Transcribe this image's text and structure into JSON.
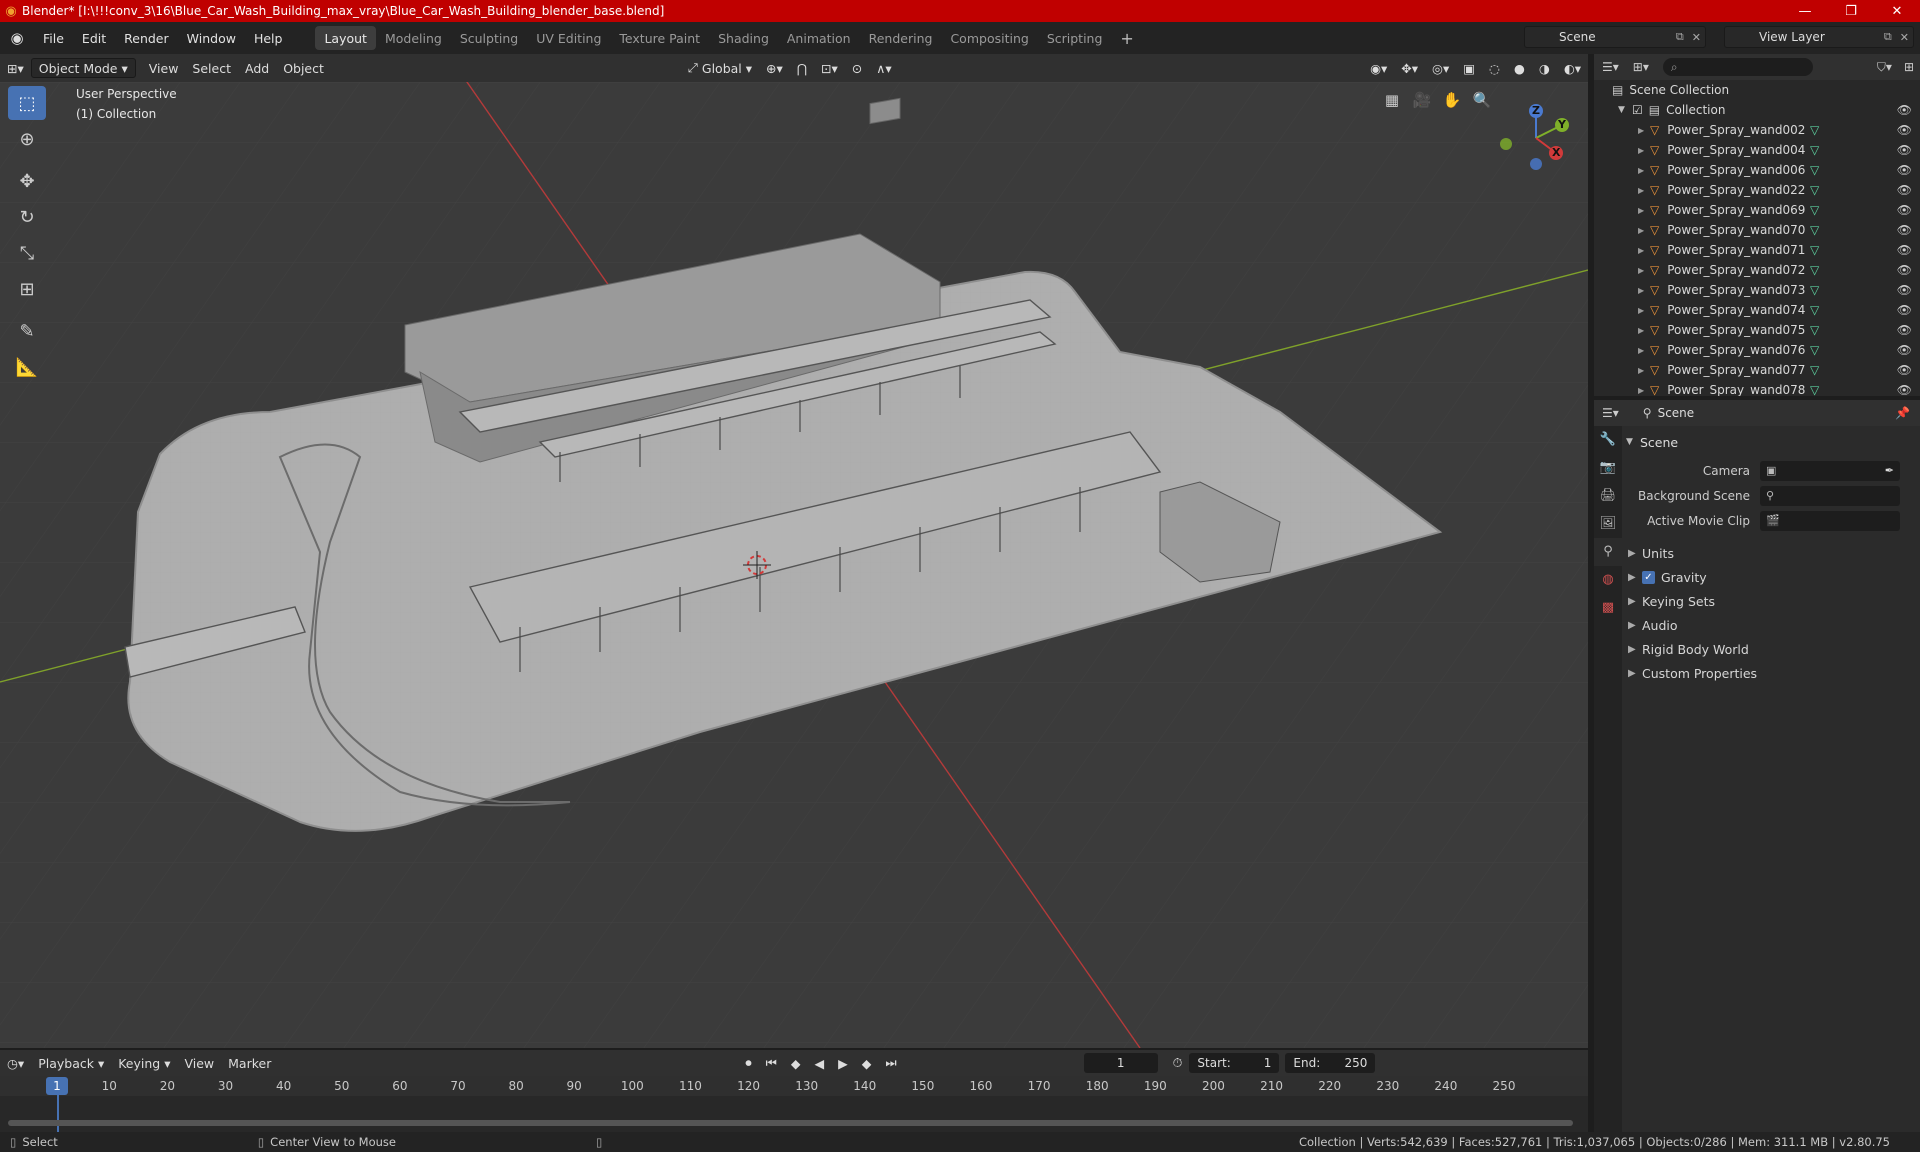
{
  "window": {
    "title": "Blender* [I:\\!!!conv_3\\16\\Blue_Car_Wash_Building_max_vray\\Blue_Car_Wash_Building_blender_base.blend]"
  },
  "menu": [
    "File",
    "Edit",
    "Render",
    "Window",
    "Help"
  ],
  "workspaces": [
    "Layout",
    "Modeling",
    "Sculpting",
    "UV Editing",
    "Texture Paint",
    "Shading",
    "Animation",
    "Rendering",
    "Compositing",
    "Scripting"
  ],
  "active_workspace": "Layout",
  "scene_selector": "Scene",
  "view_layer_selector": "View Layer",
  "viewport": {
    "mode": "Object Mode",
    "menus": [
      "View",
      "Select",
      "Add",
      "Object"
    ],
    "orientation": "Global",
    "info_line1": "User Perspective",
    "info_line2": "(1) Collection",
    "gizmo": {
      "x": "X",
      "y": "Y",
      "z": "Z"
    }
  },
  "outliner": {
    "root": "Scene Collection",
    "collection": "Collection",
    "items": [
      "Power_Spray_wand002",
      "Power_Spray_wand004",
      "Power_Spray_wand006",
      "Power_Spray_wand022",
      "Power_Spray_wand069",
      "Power_Spray_wand070",
      "Power_Spray_wand071",
      "Power_Spray_wand072",
      "Power_Spray_wand073",
      "Power_Spray_wand074",
      "Power_Spray_wand075",
      "Power_Spray_wand076",
      "Power_Spray_wand077",
      "Power_Spray_wand078"
    ]
  },
  "properties": {
    "context": "Scene",
    "panel": "Scene",
    "camera_label": "Camera",
    "background_scene_label": "Background Scene",
    "active_movie_clip_label": "Active Movie Clip",
    "subpanels": [
      "Units",
      "Gravity",
      "Keying Sets",
      "Audio",
      "Rigid Body World",
      "Custom Properties"
    ]
  },
  "timeline": {
    "menus": [
      "Playback",
      "Keying",
      "View",
      "Marker"
    ],
    "current_frame": "1",
    "start_label": "Start:",
    "start": "1",
    "end_label": "End:",
    "end": "250",
    "ticks": [
      "1",
      "10",
      "20",
      "30",
      "40",
      "50",
      "60",
      "70",
      "80",
      "90",
      "100",
      "110",
      "120",
      "130",
      "140",
      "150",
      "160",
      "170",
      "180",
      "190",
      "200",
      "210",
      "220",
      "230",
      "240",
      "250"
    ]
  },
  "status": {
    "select": "Select",
    "center": "Center View to Mouse",
    "stats": "Collection | Verts:542,639 | Faces:527,761 | Tris:1,037,065 | Objects:0/286 | Mem: 311.1 MB | v2.80.75"
  },
  "colors": {
    "accent": "#4772b3",
    "title_bar": "#c00000",
    "axis_x": "#d13a3a",
    "axis_y": "#7fb02a"
  }
}
